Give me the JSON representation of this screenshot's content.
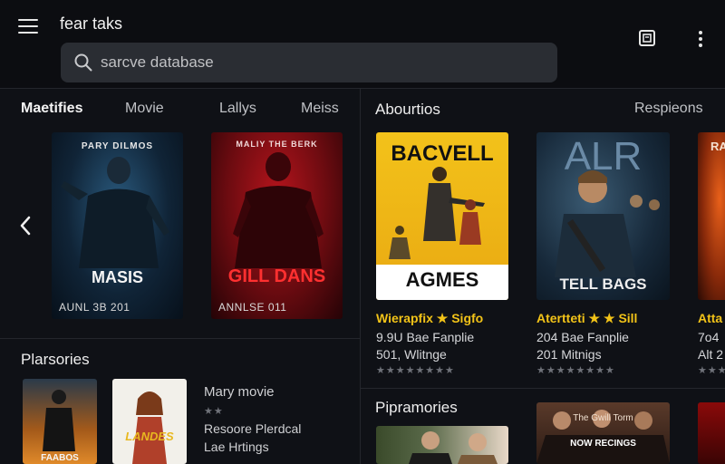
{
  "header": {
    "app_title": "fear taks",
    "search_placeholder": "sarcve database"
  },
  "left_panel": {
    "tabs": [
      "Maetifies",
      "Movie",
      "Lallys",
      "Meiss"
    ],
    "posters": [
      {
        "top": "PARY DILMOS",
        "title": "MASIS",
        "date": "AUNL 3B 201"
      },
      {
        "top": "MALIY THE BERK",
        "title": "GILL DANS",
        "date": "ANNLSE 011"
      }
    ],
    "section2": {
      "heading": "Plarsories",
      "poster_a_title": "FAABOS",
      "poster_b_title": "LANDES",
      "item_title": "Mary movie",
      "item_line2": "Resoore Plerdcal",
      "item_line3": "Lae Hrtings"
    }
  },
  "right_panel": {
    "heading": "Abourtios",
    "heading_right": "Respieons",
    "cards": [
      {
        "title": "BACVELL",
        "subtitle": "AGMES",
        "meta_title": "Wierapfix ★ Sigfo",
        "line1": "9.9U Bae Fanplie",
        "line2": "501, Wlitnge",
        "stars": "★★★★★★★★"
      },
      {
        "title": "ALR",
        "subtitle": "TELL BAGS",
        "meta_title": "Atertteti ★ ★ Sill",
        "line1": "204 Bae Fanplie",
        "line2": "201 Mitnigs",
        "stars": "★★★★★★★★"
      },
      {
        "title": "RA",
        "subtitle": "",
        "meta_title": "Atta",
        "line1": "7o4",
        "line2": "Alt 2",
        "stars": "★★★"
      }
    ],
    "section2": {
      "heading": "Pipramories",
      "poster_title": "NOW RECINGS",
      "poster_top": "The Gwill Torm"
    }
  },
  "colors": {
    "background": "#0f1116",
    "accent_yellow": "#f2c318",
    "panel": "#2a2d33"
  }
}
